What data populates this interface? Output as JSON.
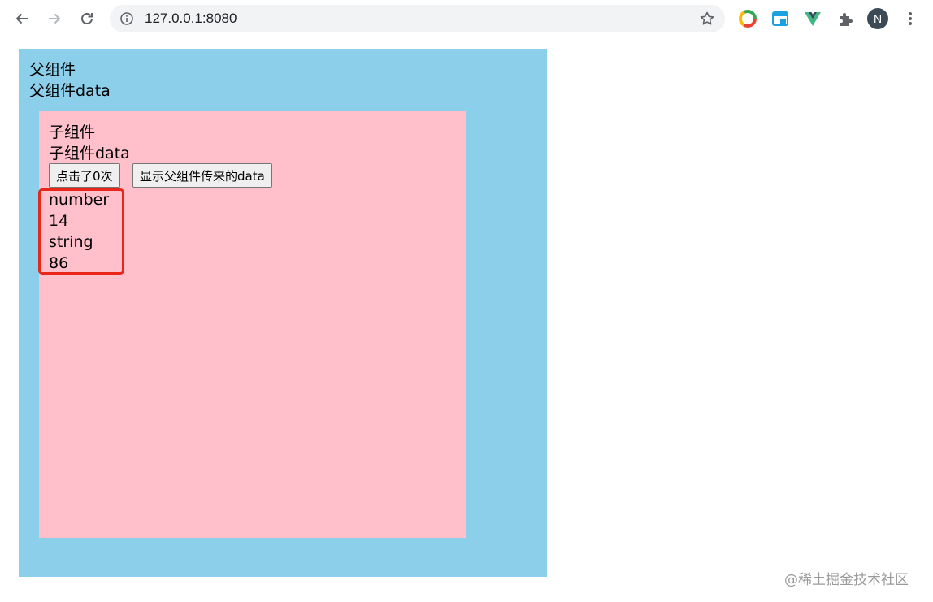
{
  "browser": {
    "url": "127.0.0.1:8080"
  },
  "parent": {
    "title": "父组件",
    "data_label": "父组件data"
  },
  "child": {
    "title": "子组件",
    "data_label": "子组件data",
    "click_button_label": "点击了0次",
    "show_data_button_label": "显示父组件传来的data",
    "values": [
      "number",
      "14",
      "string",
      "86"
    ]
  },
  "watermark": "@稀土掘金技术社区",
  "colors": {
    "parent_bg": "#8ccfeb",
    "child_bg": "#ffc0cb",
    "highlight_border": "#e8261a"
  }
}
